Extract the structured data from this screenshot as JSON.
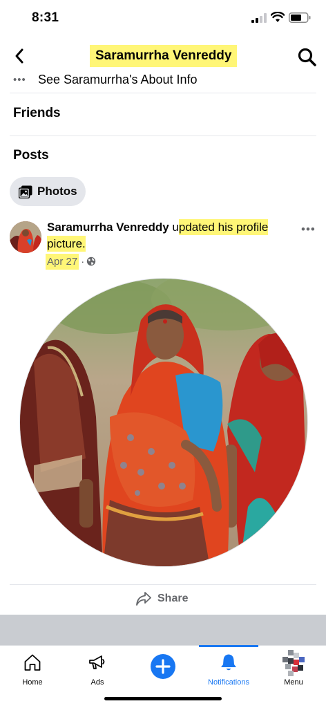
{
  "status": {
    "time": "8:31"
  },
  "header": {
    "title": "Saramurrha Venreddy"
  },
  "about": {
    "dots": "•••",
    "label": "See Saramurrha's About Info"
  },
  "sections": {
    "friends": "Friends",
    "posts": "Posts"
  },
  "filters": {
    "photos_label": "Photos"
  },
  "post": {
    "author": "Saramurrha Venreddy",
    "action_prefix": " u",
    "action_highlight": "pdated his profile picture.",
    "date": "Apr 27",
    "separator": "·",
    "more": "•••",
    "share_label": "Share"
  },
  "tabs": [
    {
      "label": "Home",
      "icon": "home-icon"
    },
    {
      "label": "Ads",
      "icon": "megaphone-icon"
    },
    {
      "label": "",
      "icon": "plus-circle-icon"
    },
    {
      "label": "Notifications",
      "icon": "bell-icon"
    },
    {
      "label": "Menu",
      "icon": "menu-avatar-icon"
    }
  ],
  "colors": {
    "accent": "#1877f2",
    "highlight": "#fff677",
    "secondary_text": "#65676b"
  }
}
